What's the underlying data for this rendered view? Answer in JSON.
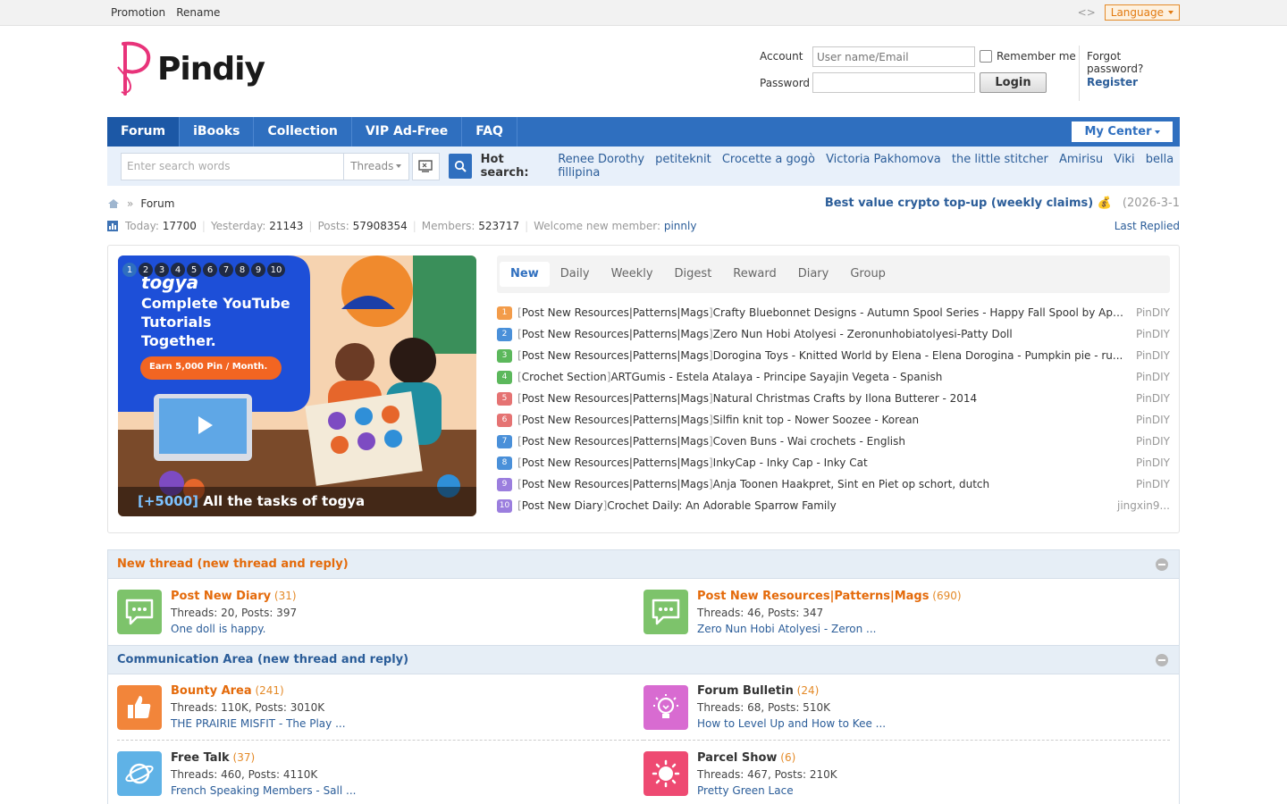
{
  "topbar": {
    "links": [
      "Promotion",
      "Rename"
    ],
    "code_icon": "<>",
    "language": "Language"
  },
  "logo": {
    "text": "Pindiy"
  },
  "login": {
    "account_label": "Account",
    "account_placeholder": "User name/Email",
    "password_label": "Password",
    "remember": "Remember me",
    "login_button": "Login",
    "forgot": "Forgot password?",
    "register": "Register"
  },
  "nav": {
    "items": [
      "Forum",
      "iBooks",
      "Collection",
      "VIP Ad-Free",
      "FAQ"
    ],
    "my_center": "My Center"
  },
  "search": {
    "placeholder": "Enter search words",
    "type": "Threads",
    "hot_label": "Hot search:",
    "hot": [
      "Renee Dorothy",
      "petiteknit",
      "Crocette a gogò",
      "Victoria Pakhomova",
      "the little stitcher",
      "Amirisu",
      "Viki",
      "bella fillipina"
    ]
  },
  "crumb": {
    "current": "Forum",
    "promo": "Best value crypto top-up (weekly claims)",
    "promo_date": "(2026-3-1"
  },
  "stats": {
    "today_label": "Today:",
    "today": "17700",
    "yesterday_label": "Yesterday:",
    "yesterday": "21143",
    "posts_label": "Posts:",
    "posts": "57908354",
    "members_label": "Members:",
    "members": "523717",
    "welcome_label": "Welcome new member:",
    "welcome": "pinnly",
    "last_replied": "Last Replied"
  },
  "banner": {
    "slides": [
      "1",
      "2",
      "3",
      "4",
      "5",
      "6",
      "7",
      "8",
      "9",
      "10"
    ],
    "brand": "togya",
    "headline": [
      "Complete YouTube",
      "Tutorials",
      "Together."
    ],
    "cta": "Earn 5,000 Pin / Month.",
    "caption_plus": "[+5000]",
    "caption": "All the tasks of togya"
  },
  "tabs": [
    "New",
    "Daily",
    "Weekly",
    "Digest",
    "Reward",
    "Diary",
    "Group"
  ],
  "threads": [
    {
      "n": "1",
      "color": "#f39c4a",
      "cat": "Post New Resources|Patterns|Mags",
      "title": "Crafty Bluebonnet Designs - Autumn Spool Series - Happy Fall Spool by Apr...",
      "author": "PinDIY"
    },
    {
      "n": "2",
      "color": "#4a90d9",
      "cat": "Post New Resources|Patterns|Mags",
      "title": "Zero Nun Hobi Atolyesi - Zeronunhobiatolyesi-Patty Doll",
      "author": "PinDIY"
    },
    {
      "n": "3",
      "color": "#5cb85c",
      "cat": "Post New Resources|Patterns|Mags",
      "title": "Dorogina Toys - Knitted World by Elena - Elena Dorogina - Pumpkin pie - ru...",
      "author": "PinDIY"
    },
    {
      "n": "4",
      "color": "#5cb85c",
      "cat": "Crochet Section",
      "title": "ARTGumis - Estela Atalaya - Principe Sayajin Vegeta - Spanish",
      "author": "PinDIY"
    },
    {
      "n": "5",
      "color": "#e57373",
      "cat": "Post New Resources|Patterns|Mags",
      "title": "Natural Christmas Crafts by Ilona Butterer - 2014",
      "author": "PinDIY"
    },
    {
      "n": "6",
      "color": "#e57373",
      "cat": "Post New Resources|Patterns|Mags",
      "title": "Silfin knit top - Nower Soozee - Korean",
      "author": "PinDIY"
    },
    {
      "n": "7",
      "color": "#4a90d9",
      "cat": "Post New Resources|Patterns|Mags",
      "title": "Coven Buns - Wai crochets - English",
      "author": "PinDIY"
    },
    {
      "n": "8",
      "color": "#4a90d9",
      "cat": "Post New Resources|Patterns|Mags",
      "title": "InkyCap - Inky Cap - Inky Cat",
      "author": "PinDIY"
    },
    {
      "n": "9",
      "color": "#9b7ede",
      "cat": "Post New Resources|Patterns|Mags",
      "title": "Anja Toonen Haakpret, Sint en Piet op schort, dutch",
      "author": "PinDIY"
    },
    {
      "n": "10",
      "color": "#9b7ede",
      "cat": "Post New Diary",
      "title": "Crochet Daily: An Adorable Sparrow Family",
      "author": "jingxin9..."
    }
  ],
  "sections": [
    {
      "title": "New thread (new thread and reply)",
      "forums": [
        {
          "name": "Post New Diary",
          "count": "(31)",
          "stat": "Threads: 20, Posts: 397",
          "last": "One doll is happy.",
          "icon": "chat-icon",
          "color": "#7dc36b"
        },
        {
          "name": "Post New Resources|Patterns|Mags",
          "count": "(690)",
          "stat": "Threads: 46, Posts: 347",
          "last": "Zero Nun Hobi Atolyesi - Zeron ...",
          "icon": "chat-icon",
          "color": "#7dc36b"
        }
      ]
    },
    {
      "title": "Communication Area (new thread and reply)",
      "forums": [
        {
          "name": "Bounty Area",
          "count": "(241)",
          "stat": "Threads: 110K, Posts: 3010K",
          "last": "THE PRAIRIE MISFIT - The Play ...",
          "icon": "thumbs-up-icon",
          "color": "#f2853a"
        },
        {
          "name": "Forum Bulletin",
          "count": "(24)",
          "stat": "Threads: 68, Posts: 510K",
          "last": "How to Level Up and How to Kee ...",
          "icon": "lightbulb-icon",
          "color": "#d86bd1"
        },
        {
          "name": "Free Talk",
          "count": "(37)",
          "stat": "Threads: 460, Posts: 4110K",
          "last": "French Speaking Members - Sall ...",
          "icon": "planet-icon",
          "color": "#5fb2e6"
        },
        {
          "name": "Parcel Show",
          "count": "(6)",
          "stat": "Threads: 467, Posts: 210K",
          "last": "Pretty Green Lace",
          "icon": "sun-icon",
          "color": "#ee4a72"
        }
      ]
    }
  ]
}
